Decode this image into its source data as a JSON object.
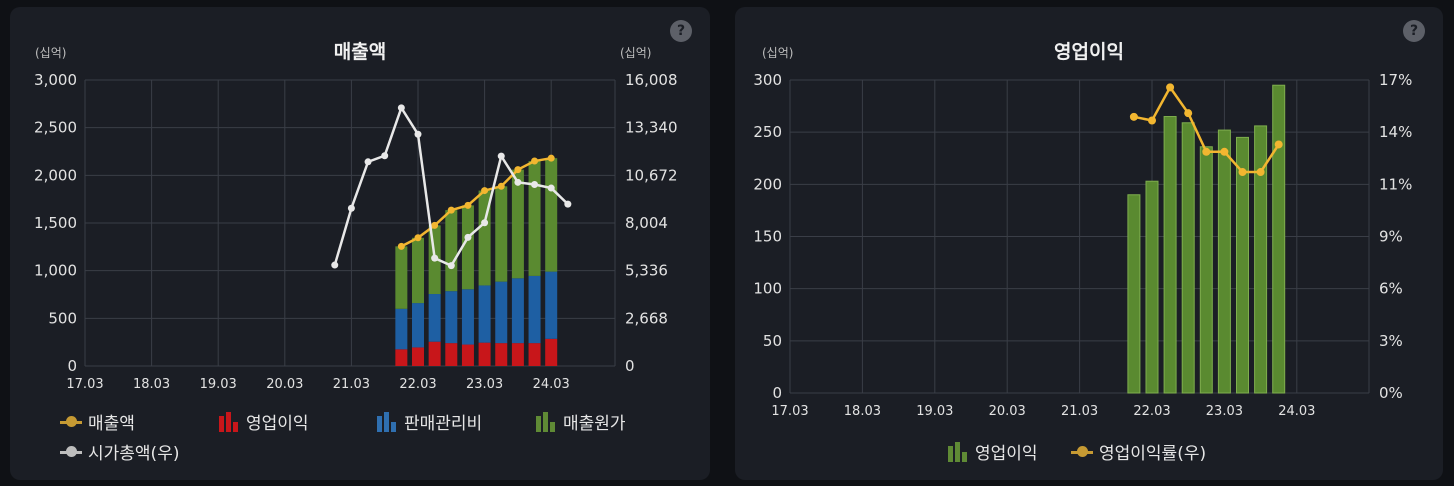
{
  "panels": {
    "left": {
      "title": "매출액",
      "unit_left": "(십억)",
      "unit_right": "(십억)",
      "help": "?",
      "legend": [
        {
          "label": "매출액",
          "icon": "line-dot-icon",
          "color": "#f2b630"
        },
        {
          "label": "영업이익",
          "icon": "bar-icon",
          "color": "#d0191c"
        },
        {
          "label": "판매관리비",
          "icon": "bar-icon",
          "color": "#2f6fb0"
        },
        {
          "label": "매출원가",
          "icon": "bar-icon",
          "color": "#6b9a3c"
        },
        {
          "label": "시가총액(우)",
          "icon": "line-dot-icon",
          "color": "#e8e8e8"
        }
      ]
    },
    "right": {
      "title": "영업이익",
      "unit_left": "(십억)",
      "help": "?",
      "legend": [
        {
          "label": "영업이익",
          "icon": "bar-icon",
          "color": "#6b9a3c"
        },
        {
          "label": "영업이익률(우)",
          "icon": "line-dot-icon",
          "color": "#f2b630"
        }
      ]
    }
  },
  "chart_data": [
    {
      "type": "bar",
      "title": "매출액",
      "x_tick_labels": [
        "17.03",
        "18.03",
        "19.03",
        "20.03",
        "21.03",
        "22.03",
        "23.03",
        "24.03"
      ],
      "y_left": {
        "ticks": [
          "0",
          "500",
          "1,000",
          "1,500",
          "2,000",
          "2,500",
          "3,000"
        ],
        "range": [
          0,
          3000
        ]
      },
      "y_right": {
        "ticks": [
          "0",
          "2,668",
          "5,336",
          "8,004",
          "10,672",
          "13,340",
          "16,008"
        ],
        "range": [
          0,
          16008
        ]
      },
      "bar_quarters": [
        "21.12",
        "22.03",
        "22.06",
        "22.09",
        "22.12",
        "23.03",
        "23.06",
        "23.09",
        "23.12",
        "24.03"
      ],
      "series": [
        {
          "name": "영업이익",
          "kind": "stacked-bar",
          "color": "#d0191c",
          "values": [
            175,
            195,
            255,
            240,
            225,
            245,
            240,
            240,
            240,
            285
          ]
        },
        {
          "name": "판매관리비",
          "kind": "stacked-bar",
          "color": "#2f6fb0",
          "values": [
            425,
            465,
            500,
            545,
            580,
            600,
            645,
            680,
            705,
            705
          ]
        },
        {
          "name": "매출원가",
          "kind": "stacked-bar",
          "color": "#6b9a3c",
          "values": [
            655,
            685,
            720,
            850,
            880,
            995,
            1000,
            1140,
            1205,
            1190
          ]
        },
        {
          "name": "매출액",
          "kind": "line",
          "color": "#f2b630",
          "values": [
            1255,
            1345,
            1475,
            1635,
            1685,
            1840,
            1885,
            2060,
            2150,
            2180
          ]
        },
        {
          "name": "시가총액(우)",
          "kind": "line",
          "axis": "right",
          "color": "#e8e8e8",
          "quarters": [
            "20.12",
            "21.03",
            "21.06",
            "21.09",
            "21.12",
            "22.03",
            "22.06",
            "22.09",
            "22.12",
            "23.03",
            "23.06",
            "23.09",
            "23.12",
            "24.03",
            "24.06"
          ],
          "values": [
            5650,
            8830,
            11430,
            11770,
            14450,
            12970,
            6040,
            5620,
            7200,
            8020,
            11750,
            10280,
            10160,
            9960,
            9060
          ]
        }
      ],
      "grid": true,
      "legend_position": "bottom"
    },
    {
      "type": "bar",
      "title": "영업이익",
      "x_tick_labels": [
        "17.03",
        "18.03",
        "19.03",
        "20.03",
        "21.03",
        "22.03",
        "23.03",
        "24.03"
      ],
      "y_left": {
        "ticks": [
          "0",
          "50",
          "100",
          "150",
          "200",
          "250",
          "300"
        ],
        "range": [
          0,
          300
        ]
      },
      "y_right": {
        "ticks": [
          "0%",
          "3%",
          "6%",
          "9%",
          "11%",
          "14%",
          "17%"
        ],
        "range": [
          0,
          17
        ]
      },
      "bar_quarters": [
        "21.12",
        "22.03",
        "22.06",
        "22.09",
        "22.12",
        "23.03",
        "23.06",
        "23.09",
        "23.12",
        "24.03"
      ],
      "series": [
        {
          "name": "영업이익",
          "kind": "bar",
          "color": "#6b9a3c",
          "values": [
            190,
            203,
            265,
            259,
            236,
            252,
            245,
            256,
            295
          ]
        },
        {
          "name": "영업이익률(우)",
          "kind": "line",
          "axis": "right",
          "color": "#f2b630",
          "values": [
            15.0,
            14.8,
            16.6,
            15.2,
            13.1,
            13.1,
            12.0,
            12.0,
            13.5
          ]
        }
      ],
      "grid": true,
      "legend_position": "bottom"
    }
  ]
}
